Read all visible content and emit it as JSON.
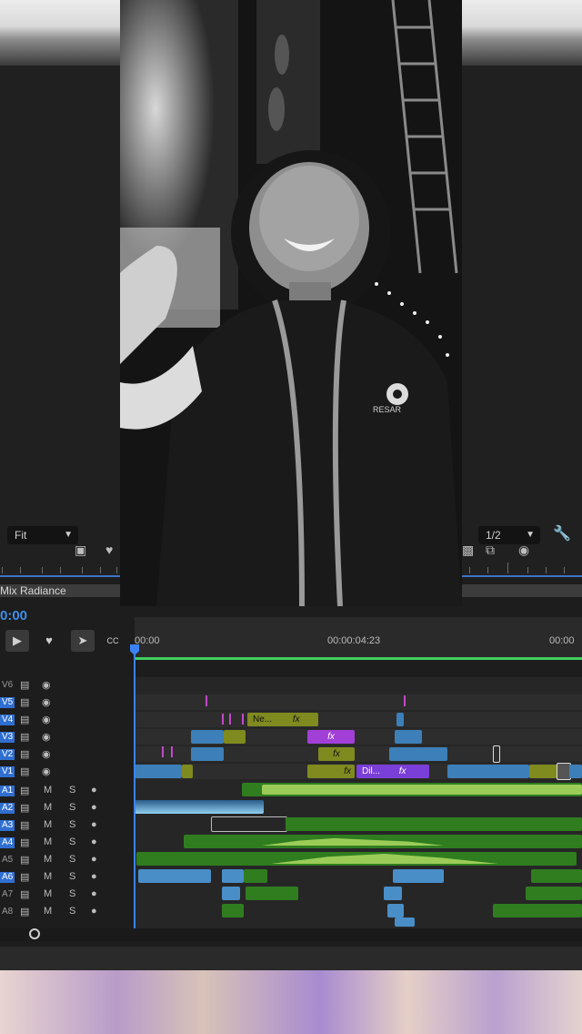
{
  "source_monitor": {
    "zoom": "Fit"
  },
  "program_monitor": {
    "zoom": "1/2"
  },
  "sequence": {
    "name": "Mix Radiance",
    "timecode": "0:00"
  },
  "ruler": {
    "labels": [
      "00:00",
      "00:00:04:23",
      "00:00"
    ]
  },
  "video": {
    "shirt_logo_text": "RESAR"
  },
  "tools": {
    "cc_label": "CC"
  },
  "video_tracks": [
    "V6",
    "V5",
    "V4",
    "V3",
    "V2",
    "V1"
  ],
  "audio_tracks": [
    "A1",
    "A2",
    "A3",
    "A4",
    "A5",
    "A6",
    "A7",
    "A8"
  ],
  "audio_buttons": {
    "mute": "M",
    "solo": "S"
  },
  "clips": {
    "v4_label": "Ne...",
    "fx": "fx",
    "v1_label": "Dil..."
  },
  "colors": {
    "accent_blue": "#3b82f6",
    "work_area_green": "#3fcf60",
    "clip_olive": "#7f8a1f",
    "clip_purple": "#a13fd6",
    "audio_green": "#2f7d1f"
  }
}
